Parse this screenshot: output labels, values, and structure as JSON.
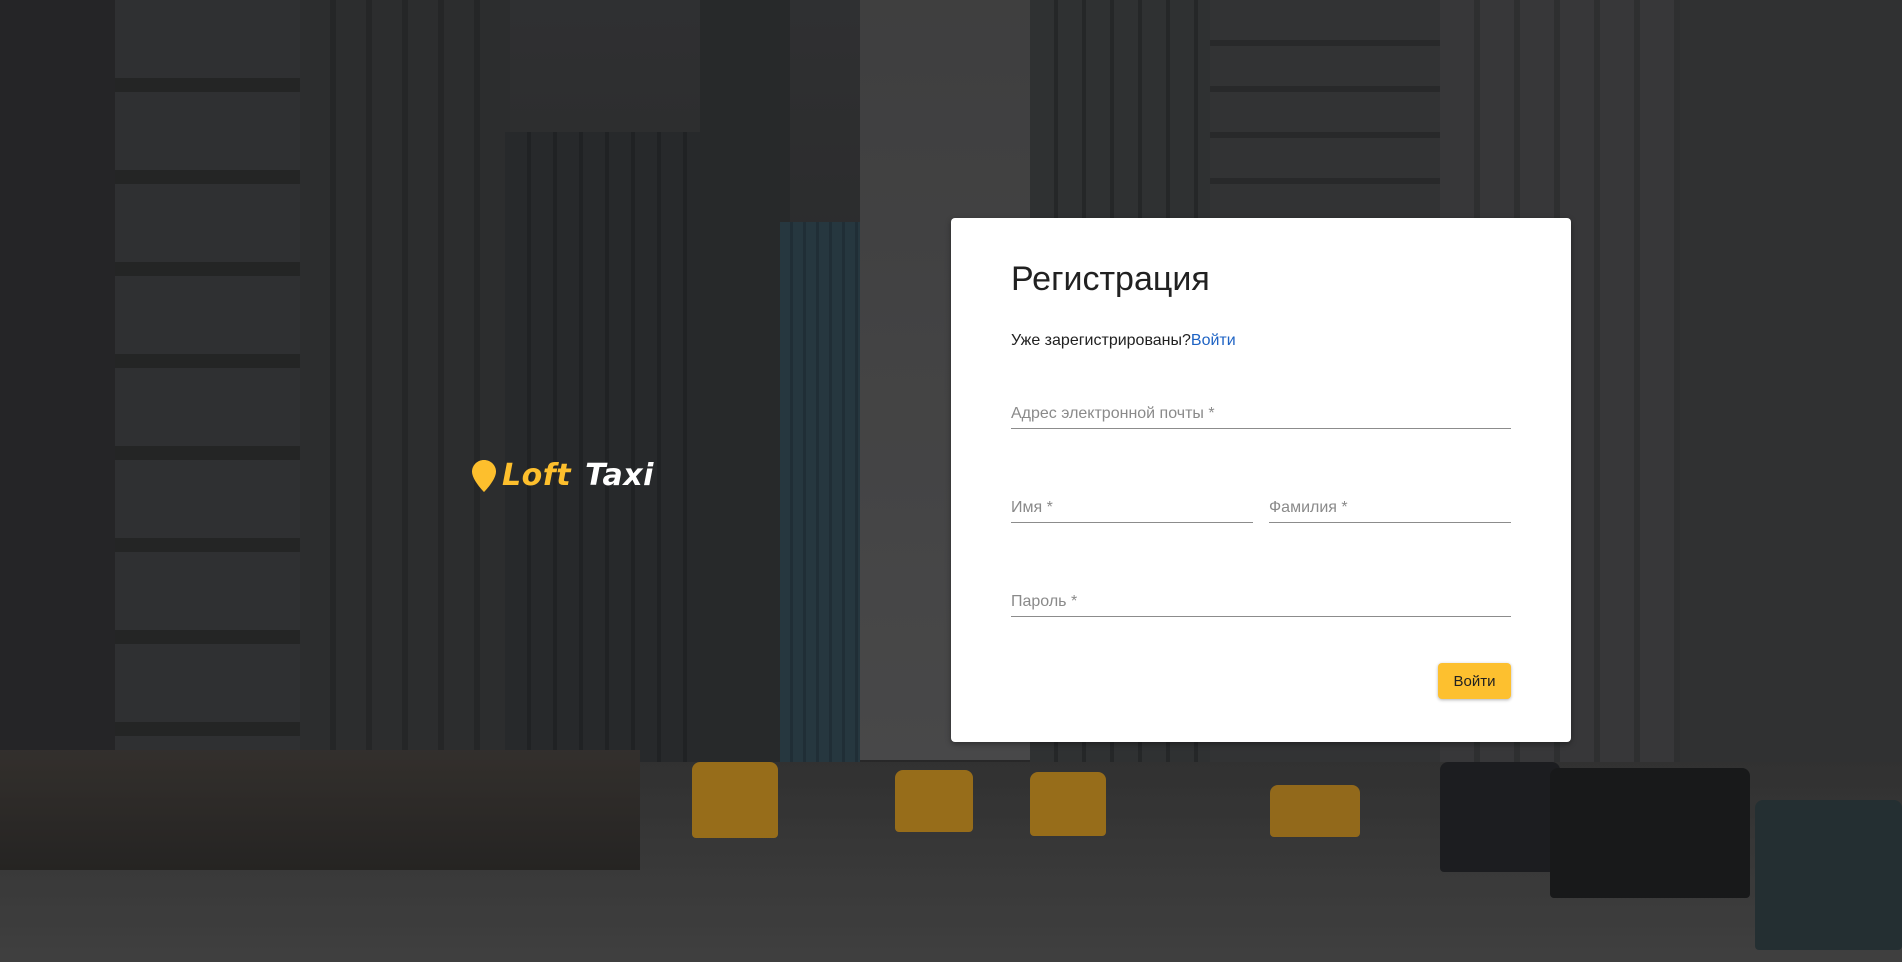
{
  "logo": {
    "word1": "Loft",
    "word2": "Taxi",
    "pin_color": "#fdbf2d"
  },
  "register": {
    "title": "Регистрация",
    "already_text": "Уже зарегистрированы?",
    "login_link": "Войти",
    "email_placeholder": "Адрес электронной почты *",
    "first_name_placeholder": "Имя *",
    "last_name_placeholder": "Фамилия *",
    "password_placeholder": "Пароль *",
    "submit_label": "Войти"
  },
  "colors": {
    "accent": "#fdc02f",
    "link": "#1e63c4"
  }
}
